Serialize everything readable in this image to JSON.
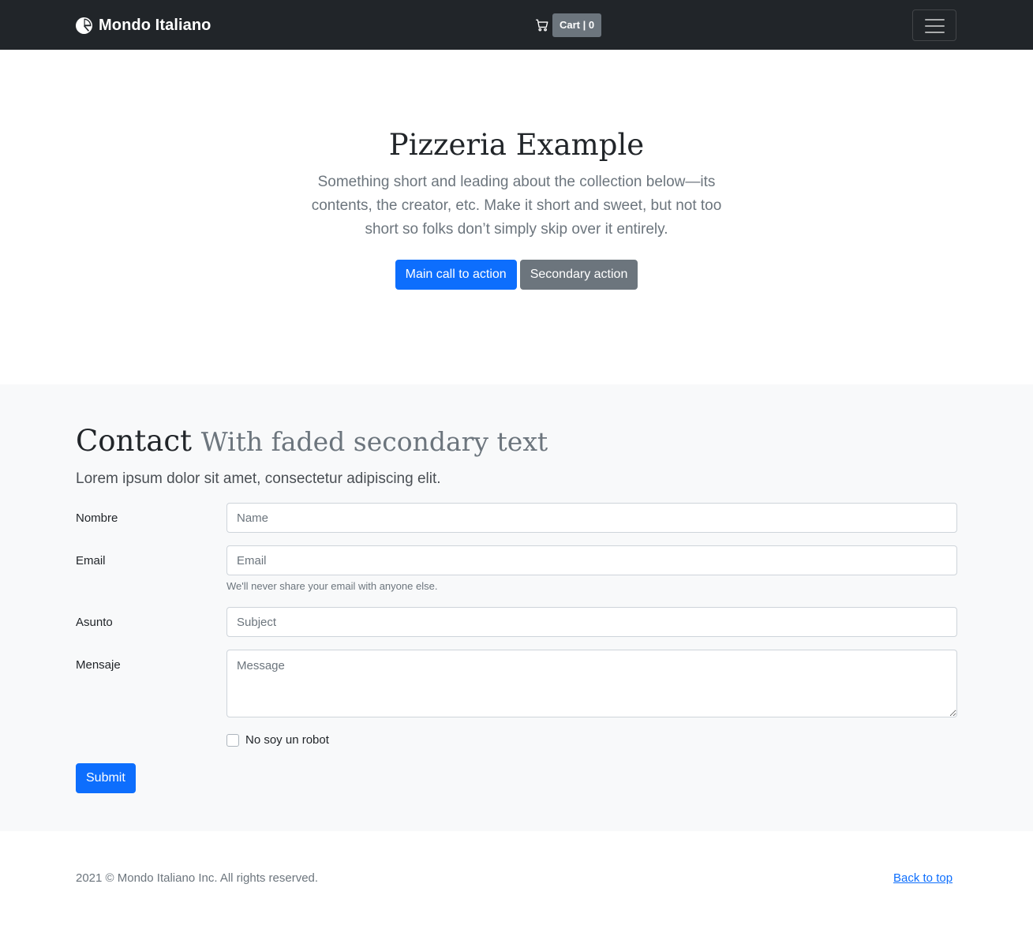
{
  "navbar": {
    "brand": "Mondo Italiano",
    "brand_icon": "pie-chart-icon",
    "cart_icon": "cart-icon",
    "cart_label": "Cart | 0",
    "menu_icon": "hamburger-menu-icon",
    "background": "#212529"
  },
  "hero": {
    "title": "Pizzeria Example",
    "lead": "Something short and leading about the collection below—its contents, the creator, etc. Make it short and sweet, but not too short so folks don’t simply skip over it entirely.",
    "primary_button": "Main call to action",
    "secondary_button": "Secondary action"
  },
  "contact": {
    "heading": "Contact",
    "heading_muted": "With faded secondary text",
    "lead": "Lorem ipsum dolor sit amet, consectetur adipiscing elit.",
    "fields": {
      "name": {
        "label": "Nombre",
        "placeholder": "Name",
        "value": ""
      },
      "email": {
        "label": "Email",
        "placeholder": "Email",
        "value": "",
        "help": "We'll never share your email with anyone else."
      },
      "subject": {
        "label": "Asunto",
        "placeholder": "Subject",
        "value": ""
      },
      "message": {
        "label": "Mensaje",
        "placeholder": "Message",
        "value": ""
      }
    },
    "checkbox_label": "No soy un robot",
    "checkbox_checked": false,
    "submit_label": "Submit"
  },
  "footer": {
    "copyright": "2021 © Mondo Italiano Inc. All rights reserved.",
    "back_to_top": "Back to top"
  },
  "colors": {
    "primary": "#0d6efd",
    "secondary": "#6c757d",
    "light_bg": "#f8f9fa",
    "dark": "#212529"
  }
}
